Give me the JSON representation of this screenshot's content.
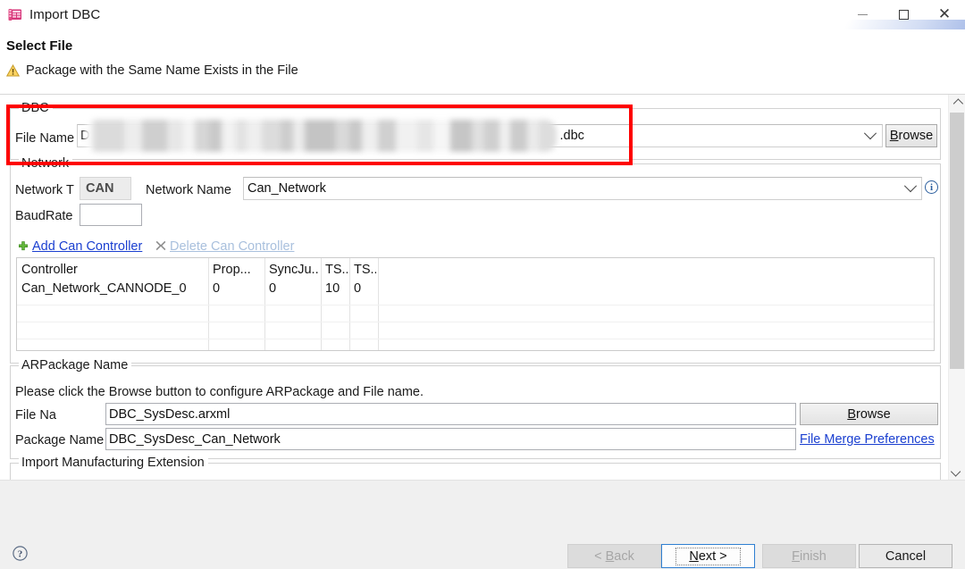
{
  "window": {
    "title": "Import DBC",
    "icon": "dbc-table-icon",
    "minimize_label": "Minimize",
    "maximize_label": "Maximize",
    "close_label": "Close"
  },
  "header": {
    "title": "Select File",
    "message": "Package with the Same Name Exists in the File",
    "message_icon": "warning-triangle-icon"
  },
  "dbc_group": {
    "legend": "DBC",
    "file_name_label": "File Name",
    "file_name_prefix": "D:",
    "file_name_suffix": ".dbc",
    "file_name_redacted": true,
    "browse_label": "Browse",
    "dropdown_icon": "chevron-down-icon",
    "highlight_color": "#fe0000"
  },
  "network_group": {
    "legend": "Network",
    "network_type_label": "Network T",
    "network_type_value": "CAN",
    "network_name_label": "Network Name",
    "network_name_value": "Can_Network",
    "network_name_dropdown_icon": "chevron-down-icon",
    "info_icon": "info-icon",
    "baudrate_label": "BaudRate",
    "baudrate_value": "",
    "add_controller_label": "Add Can Controller",
    "add_controller_icon": "plus-icon",
    "delete_controller_label": "Delete Can Controller",
    "delete_controller_icon": "cross-icon",
    "table": {
      "columns": [
        "Controller",
        "Prop...",
        "SyncJu...",
        "TS...",
        "TS...",
        ""
      ],
      "rows": [
        [
          "Can_Network_CANNODE_0",
          "0",
          "0",
          "10",
          "0",
          ""
        ]
      ],
      "empty_rows": 3
    }
  },
  "arpackage_group": {
    "legend": "ARPackage Name",
    "hint": "Please click the Browse button to configure ARPackage and File name.",
    "file_name_label": "File Na",
    "file_name_value": "DBC_SysDesc.arxml",
    "browse_label": "Browse",
    "package_name_label": "Package Name",
    "package_name_value": "DBC_SysDesc_Can_Network",
    "file_merge_preferences_label": "File Merge Preferences"
  },
  "manufacturing_group": {
    "legend": "Import Manufacturing Extension"
  },
  "scrollbar": {
    "up_icon": "chevron-up-icon",
    "down_icon": "chevron-down-icon"
  },
  "footer": {
    "help_icon": "help-question-icon",
    "back_label": "< Back",
    "next_label": "Next >",
    "finish_label": "Finish",
    "cancel_label": "Cancel"
  }
}
